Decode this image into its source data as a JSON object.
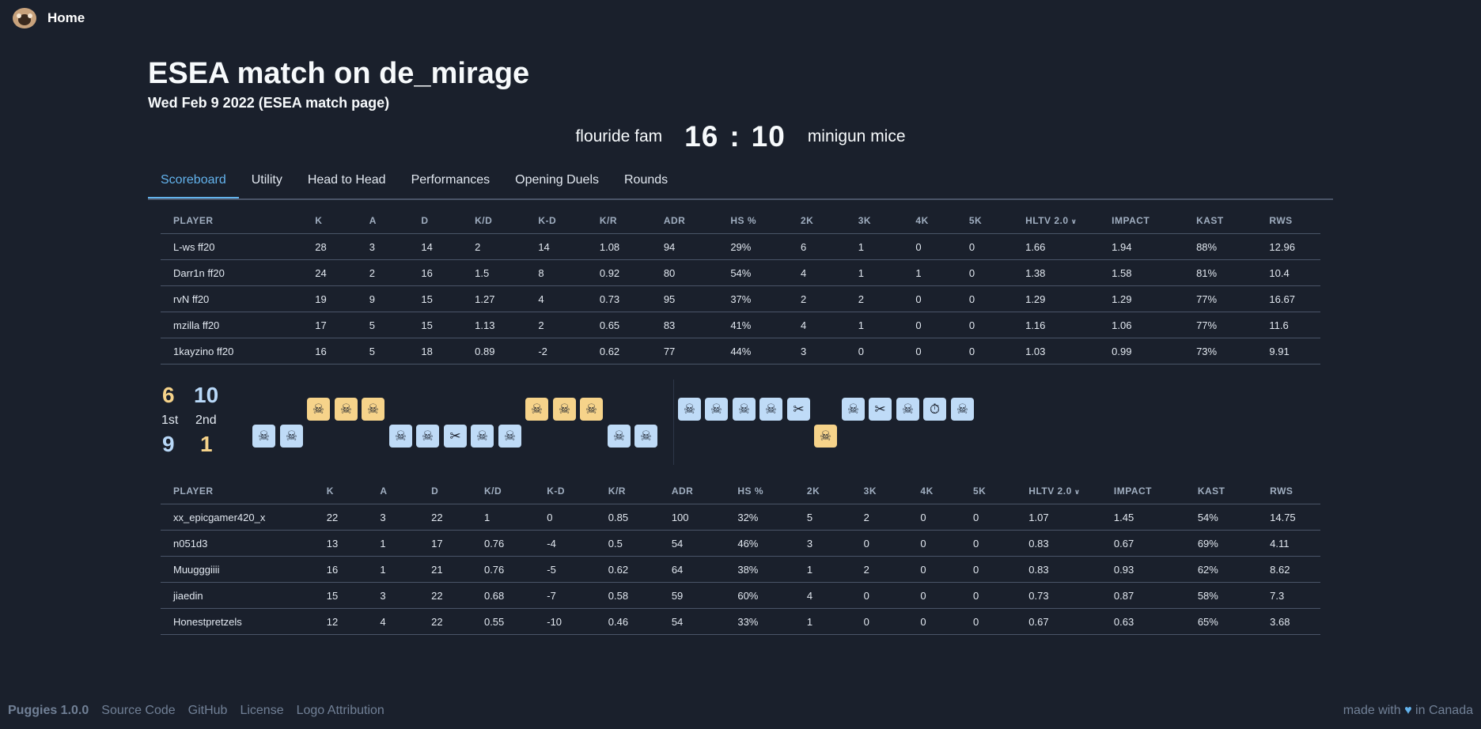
{
  "nav": {
    "home_label": "Home"
  },
  "page": {
    "title": "ESEA match on de_mirage",
    "subtitle": "Wed Feb 9 2022 (ESEA match page)"
  },
  "match": {
    "team1": "flouride fam",
    "score1": "16",
    "separator": ":",
    "score2": "10",
    "team2": "minigun mice"
  },
  "tabs": [
    "Scoreboard",
    "Utility",
    "Head to Head",
    "Performances",
    "Opening Duels",
    "Rounds"
  ],
  "columns": [
    "PLAYER",
    "K",
    "A",
    "D",
    "K/D",
    "K-D",
    "K/R",
    "ADR",
    "HS %",
    "2K",
    "3K",
    "4K",
    "5K",
    "HLTV 2.0",
    "IMPACT",
    "KAST",
    "RWS"
  ],
  "team1_rows": [
    [
      "L-ws ff20",
      "28",
      "3",
      "14",
      "2",
      "14",
      "1.08",
      "94",
      "29%",
      "6",
      "1",
      "0",
      "0",
      "1.66",
      "1.94",
      "88%",
      "12.96"
    ],
    [
      "Darr1n ff20",
      "24",
      "2",
      "16",
      "1.5",
      "8",
      "0.92",
      "80",
      "54%",
      "4",
      "1",
      "1",
      "0",
      "1.38",
      "1.58",
      "81%",
      "10.4"
    ],
    [
      "rvN ff20",
      "19",
      "9",
      "15",
      "1.27",
      "4",
      "0.73",
      "95",
      "37%",
      "2",
      "2",
      "0",
      "0",
      "1.29",
      "1.29",
      "77%",
      "16.67"
    ],
    [
      "mzilla ff20",
      "17",
      "5",
      "15",
      "1.13",
      "2",
      "0.65",
      "83",
      "41%",
      "4",
      "1",
      "0",
      "0",
      "1.16",
      "1.06",
      "77%",
      "11.6"
    ],
    [
      "1kayzino ff20",
      "16",
      "5",
      "18",
      "0.89",
      "-2",
      "0.62",
      "77",
      "44%",
      "3",
      "0",
      "0",
      "0",
      "1.03",
      "0.99",
      "73%",
      "9.91"
    ]
  ],
  "team2_rows": [
    [
      "xx_epicgamer420_x",
      "22",
      "3",
      "22",
      "1",
      "0",
      "0.85",
      "100",
      "32%",
      "5",
      "2",
      "0",
      "0",
      "1.07",
      "1.45",
      "54%",
      "14.75"
    ],
    [
      "n051d3",
      "13",
      "1",
      "17",
      "0.76",
      "-4",
      "0.5",
      "54",
      "46%",
      "3",
      "0",
      "0",
      "0",
      "0.83",
      "0.67",
      "69%",
      "4.11"
    ],
    [
      "Muugggiiii",
      "16",
      "1",
      "21",
      "0.76",
      "-5",
      "0.62",
      "64",
      "38%",
      "1",
      "2",
      "0",
      "0",
      "0.83",
      "0.93",
      "62%",
      "8.62"
    ],
    [
      "jiaedin",
      "15",
      "3",
      "22",
      "0.68",
      "-7",
      "0.58",
      "59",
      "60%",
      "4",
      "0",
      "0",
      "0",
      "0.73",
      "0.87",
      "58%",
      "7.3"
    ],
    [
      "Honestpretzels",
      "12",
      "4",
      "22",
      "0.55",
      "-10",
      "0.46",
      "54",
      "33%",
      "1",
      "0",
      "0",
      "0",
      "0.67",
      "0.63",
      "65%",
      "3.68"
    ]
  ],
  "halves": {
    "first": {
      "top": "6",
      "label": "1st",
      "bottom": "9"
    },
    "second": {
      "top": "10",
      "label": "2nd",
      "bottom": "1"
    }
  },
  "rounds": [
    {
      "team": "bottom",
      "icon": "skull"
    },
    {
      "team": "bottom",
      "icon": "skull"
    },
    {
      "team": "top",
      "icon": "skull"
    },
    {
      "team": "top",
      "icon": "skull"
    },
    {
      "team": "top",
      "icon": "skull"
    },
    {
      "team": "bottom",
      "icon": "skull"
    },
    {
      "team": "bottom",
      "icon": "skull"
    },
    {
      "team": "bottom",
      "icon": "scissors"
    },
    {
      "team": "bottom",
      "icon": "skull"
    },
    {
      "team": "bottom",
      "icon": "skull"
    },
    {
      "team": "top",
      "icon": "skull"
    },
    {
      "team": "top",
      "icon": "skull"
    },
    {
      "team": "top",
      "icon": "skull"
    },
    {
      "team": "bottom",
      "icon": "skull"
    },
    {
      "team": "bottom",
      "icon": "skull"
    },
    {
      "team": "top",
      "icon": "skull"
    },
    {
      "team": "top",
      "icon": "skull"
    },
    {
      "team": "top",
      "icon": "skull"
    },
    {
      "team": "top",
      "icon": "skull"
    },
    {
      "team": "top",
      "icon": "scissors"
    },
    {
      "team": "bottom",
      "icon": "skull"
    },
    {
      "team": "top",
      "icon": "skull"
    },
    {
      "team": "top",
      "icon": "scissors"
    },
    {
      "team": "top",
      "icon": "skull"
    },
    {
      "team": "top",
      "icon": "stopwatch"
    },
    {
      "team": "top",
      "icon": "skull"
    }
  ],
  "colors": {
    "bg": "#1a202c",
    "accent": "#63b3ed",
    "gold": "#f6d38a",
    "blue": "#bfdbf7"
  },
  "footer": {
    "brand": "Puggies 1.0.0",
    "links": [
      "Source Code",
      "GitHub",
      "License",
      "Logo Attribution"
    ],
    "made_prefix": "made with",
    "made_suffix": "in Canada"
  }
}
